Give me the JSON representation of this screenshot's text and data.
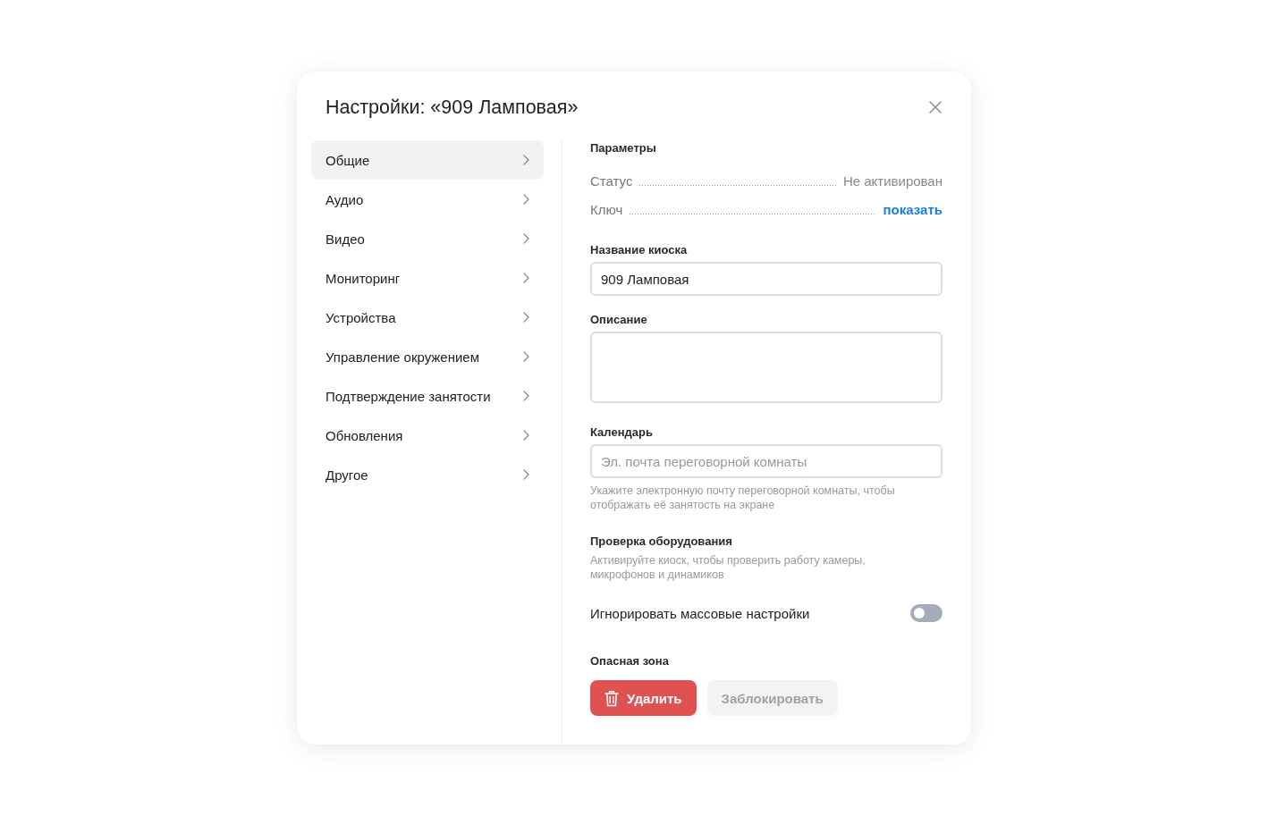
{
  "dialog": {
    "title": "Настройки: «909 Ламповая»"
  },
  "sidebar": {
    "items": [
      {
        "label": "Общие",
        "selected": true
      },
      {
        "label": "Аудио",
        "selected": false
      },
      {
        "label": "Видео",
        "selected": false
      },
      {
        "label": "Мониторинг",
        "selected": false
      },
      {
        "label": "Устройства",
        "selected": false
      },
      {
        "label": "Управление окружением",
        "selected": false
      },
      {
        "label": "Подтверждение занятости",
        "selected": false
      },
      {
        "label": "Обновления",
        "selected": false
      },
      {
        "label": "Другое",
        "selected": false
      }
    ]
  },
  "parameters": {
    "heading": "Параметры",
    "rows": [
      {
        "label": "Статус",
        "value": "Не активирован",
        "kind": "text"
      },
      {
        "label": "Ключ",
        "value": "показать",
        "kind": "link"
      }
    ]
  },
  "kiosk_name": {
    "label": "Название киоска",
    "value": "909 Ламповая"
  },
  "description": {
    "label": "Описание"
  },
  "calendar": {
    "label": "Календарь",
    "placeholder": "Эл. почта переговорной комнаты",
    "hint": "Укажите электронную почту переговорной комнаты, чтобы отображать её занятость на экране"
  },
  "hardware_check": {
    "heading": "Проверка оборудования",
    "text": "Активируйте киоск, чтобы проверить работу камеры, микрофонов и динамиков"
  },
  "ignore_bulk_settings": {
    "label": "Игнорировать массовые настройки",
    "on": false
  },
  "danger_zone": {
    "heading": "Опасная зона",
    "buttons": [
      {
        "label": "Удалить",
        "kind": "danger",
        "disabled": false
      },
      {
        "label": "Заблокировать",
        "kind": "secondary",
        "disabled": true
      }
    ]
  }
}
